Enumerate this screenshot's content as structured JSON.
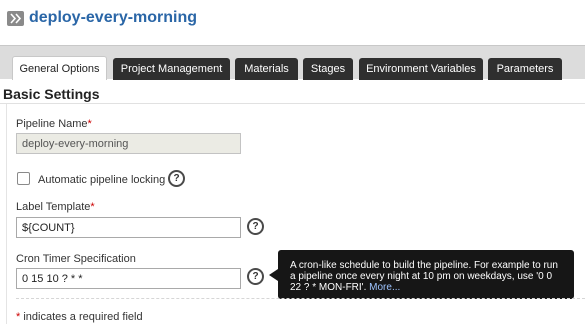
{
  "header": {
    "title": "deploy-every-morning",
    "icon": "double-chevron-right-icon"
  },
  "tabs": [
    {
      "label": "General Options",
      "active": true
    },
    {
      "label": "Project Management",
      "active": false
    },
    {
      "label": "Materials",
      "active": false
    },
    {
      "label": "Stages",
      "active": false
    },
    {
      "label": "Environment Variables",
      "active": false
    },
    {
      "label": "Parameters",
      "active": false
    }
  ],
  "section": {
    "title": "Basic Settings"
  },
  "form": {
    "pipeline_name": {
      "label": "Pipeline Name",
      "required_mark": "*",
      "value": "deploy-every-morning"
    },
    "pipeline_locking": {
      "label": "Automatic pipeline locking",
      "checked": false
    },
    "label_template": {
      "label": "Label Template",
      "required_mark": "*",
      "value": "${COUNT}"
    },
    "cron_timer": {
      "label": "Cron Timer Specification",
      "value": "0 15 10 ? * *"
    },
    "help_glyph": "?"
  },
  "tooltip": {
    "text": "A cron-like schedule to build the pipeline. For example to run a pipeline once every night at 10 pm on weekdays, use '0 0 22 ? * MON-FRI'.",
    "link": "More..."
  },
  "footer": {
    "required_mark": "*",
    "note": " indicates a required field"
  },
  "colors": {
    "title": "#2a66a7",
    "tab_dark": "#2f2f2f",
    "required": "#cc0000",
    "tooltip_bg": "#161616"
  }
}
